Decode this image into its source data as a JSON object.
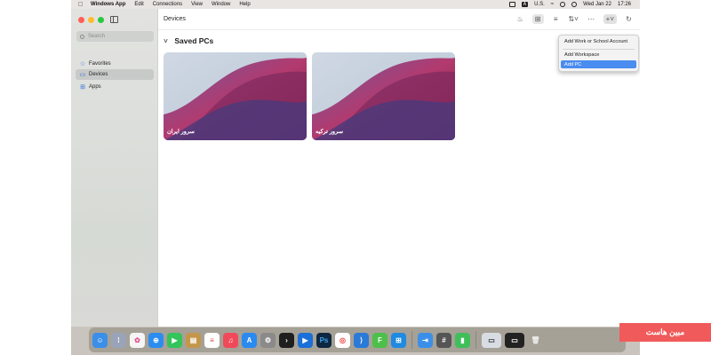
{
  "menubar": {
    "app_name": "Windows App",
    "items": [
      "Edit",
      "Connections",
      "View",
      "Window",
      "Help"
    ],
    "input_source": "U.S.",
    "date": "Wed Jan 22",
    "time": "17:26"
  },
  "sidebar": {
    "search_placeholder": "Search",
    "items": [
      {
        "label": "Favorites",
        "icon": "star-icon"
      },
      {
        "label": "Devices",
        "icon": "monitor-icon",
        "selected": true
      },
      {
        "label": "Apps",
        "icon": "apps-grid-icon"
      }
    ]
  },
  "toolbar": {
    "title": "Devices",
    "add_symbol": "+"
  },
  "section": {
    "title": "Saved PCs"
  },
  "pcs": [
    {
      "name": "سرور ایران"
    },
    {
      "name": "سرور ترکیه"
    }
  ],
  "add_menu": {
    "items": [
      "Add Work or School Account",
      "Add Workspace",
      "Add PC"
    ],
    "highlighted": "Add PC"
  },
  "dock": {
    "apps": [
      "Finder",
      "Launchpad",
      "Photos",
      "Safari",
      "FaceTime",
      "Books",
      "Reminders",
      "Music",
      "App Store",
      "System Settings",
      "Terminal",
      "Prime Video",
      "Photoshop",
      "Chrome",
      "VS Code",
      "Numbers",
      "Windows App",
      "Migration",
      "Calculator",
      "Numbers Chart",
      "Preview",
      "Screenshot",
      "Trash"
    ]
  },
  "watermark": {
    "text": "مبین هاست"
  },
  "colors": {
    "accent": "#4a8cf0",
    "watermark": "#f15a5a"
  }
}
